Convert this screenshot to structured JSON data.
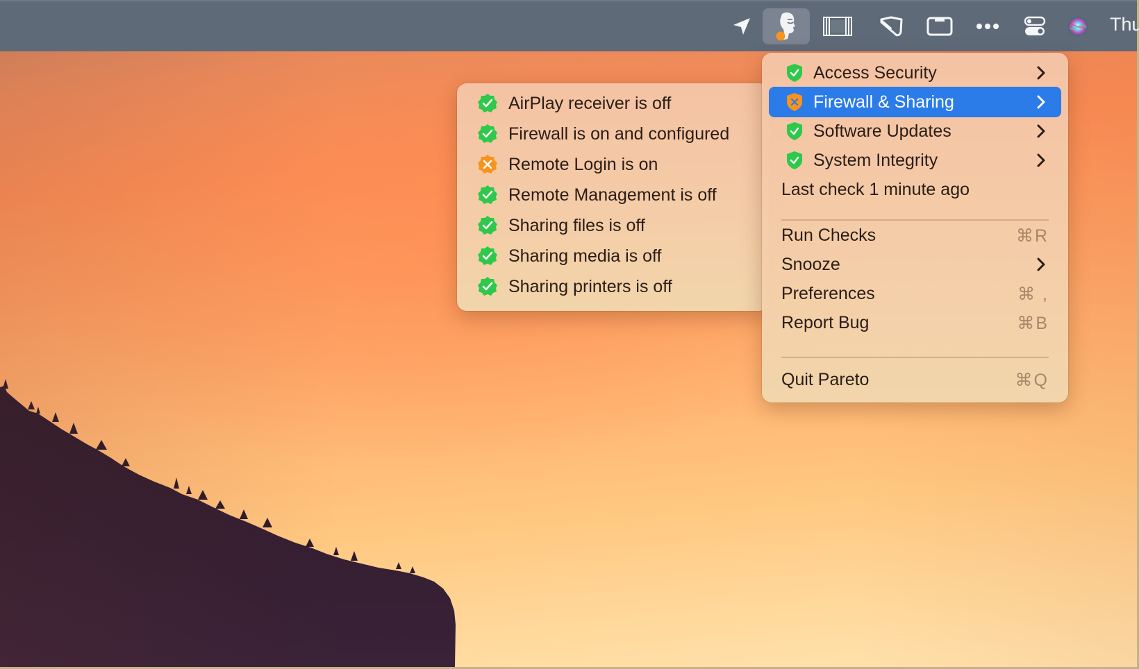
{
  "menubar": {
    "icons": [
      {
        "name": "location-arrow-icon"
      },
      {
        "name": "pareto-security-icon",
        "active": true,
        "badge_color": "#f7931e"
      },
      {
        "name": "window-frame-icon"
      },
      {
        "name": "tag-shape-icon"
      },
      {
        "name": "window-tab-icon"
      },
      {
        "name": "more-dots-icon"
      },
      {
        "name": "control-center-icon"
      },
      {
        "name": "siri-icon"
      }
    ],
    "clock": "Thu"
  },
  "main_menu": {
    "items": [
      {
        "label": "Access Security",
        "status": "ok",
        "has_submenu": true
      },
      {
        "label": "Firewall & Sharing",
        "status": "warning",
        "has_submenu": true,
        "highlighted": true
      },
      {
        "label": "Software Updates",
        "status": "ok",
        "has_submenu": true
      },
      {
        "label": "System Integrity",
        "status": "ok",
        "has_submenu": true
      }
    ],
    "last_check": "Last check 1 minute ago",
    "actions": [
      {
        "label": "Run Checks",
        "shortcut": "⌘R"
      },
      {
        "label": "Snooze",
        "has_submenu": true
      },
      {
        "label": "Preferences",
        "shortcut": "⌘ ,"
      },
      {
        "label": "Report Bug",
        "shortcut": "⌘B"
      }
    ],
    "quit": {
      "label": "Quit Pareto",
      "shortcut": "⌘Q"
    }
  },
  "submenu": {
    "title": "Firewall & Sharing",
    "items": [
      {
        "label": "AirPlay receiver is off",
        "status": "ok"
      },
      {
        "label": "Firewall is on and configured",
        "status": "ok"
      },
      {
        "label": "Remote Login is on",
        "status": "warning"
      },
      {
        "label": "Remote Management is off",
        "status": "ok"
      },
      {
        "label": "Sharing files is off",
        "status": "ok"
      },
      {
        "label": "Sharing media is off",
        "status": "ok"
      },
      {
        "label": "Sharing printers is off",
        "status": "ok"
      }
    ]
  },
  "colors": {
    "ok": "#2ec84a",
    "warning": "#f7931e",
    "highlight": "#2b7be8",
    "menubar": "#5e6a78"
  }
}
